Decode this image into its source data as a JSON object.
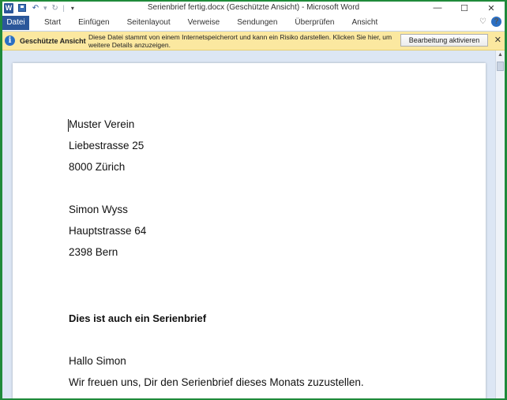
{
  "window": {
    "title": "Serienbrief fertig.docx (Geschützte Ansicht)  -  Microsoft Word",
    "controls": [
      "minimize",
      "maximize",
      "close"
    ]
  },
  "quick_access": {
    "icons": [
      "word-logo-icon",
      "save-icon",
      "undo-icon",
      "redo-icon",
      "customize-icon"
    ]
  },
  "ribbon": {
    "tabs": [
      "Datei",
      "Start",
      "Einfügen",
      "Seitenlayout",
      "Verweise",
      "Sendungen",
      "Überprüfen",
      "Ansicht"
    ]
  },
  "protected_view": {
    "title": "Geschützte Ansicht",
    "message": "Diese Datei stammt von einem Internetspeicherort und kann ein Risiko darstellen. Klicken Sie hier, um weitere Details anzuzeigen.",
    "button": "Bearbeitung aktivieren",
    "color": "#fbe8a0"
  },
  "document": {
    "lines": [
      "Muster Verein",
      "Liebestrasse 25",
      "8000 Zürich",
      "Simon Wyss",
      "Hauptstrasse 64",
      "2398 Bern",
      "Dies ist auch ein Serienbrief",
      "Hallo Simon",
      "Wir freuen uns, Dir den Serienbrief dieses Monats zuzustellen."
    ]
  },
  "accent": "#2b579a"
}
